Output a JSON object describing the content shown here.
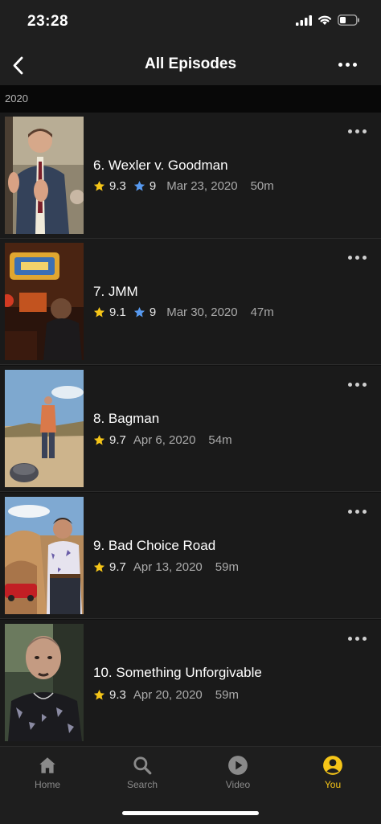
{
  "status_bar": {
    "time": "23:28"
  },
  "nav": {
    "title": "All Episodes"
  },
  "section": {
    "year": "2020"
  },
  "episodes": [
    {
      "title": "6. Wexler v. Goodman",
      "rating": "9.3",
      "user_rating": "9",
      "date": "Mar 23, 2020",
      "runtime": "50m"
    },
    {
      "title": "7. JMM",
      "rating": "9.1",
      "user_rating": "9",
      "date": "Mar 30, 2020",
      "runtime": "47m"
    },
    {
      "title": "8. Bagman",
      "rating": "9.7",
      "date": "Apr 6, 2020",
      "runtime": "54m"
    },
    {
      "title": "9. Bad Choice Road",
      "rating": "9.7",
      "date": "Apr 13, 2020",
      "runtime": "59m"
    },
    {
      "title": "10. Something Unforgivable",
      "rating": "9.3",
      "date": "Apr 20, 2020",
      "runtime": "59m"
    }
  ],
  "tabs": [
    {
      "label": "Home",
      "icon": "home-icon"
    },
    {
      "label": "Search",
      "icon": "search-icon"
    },
    {
      "label": "Video",
      "icon": "play-icon"
    },
    {
      "label": "You",
      "icon": "profile-icon",
      "active": true
    }
  ],
  "colors": {
    "accent": "#f5c518",
    "user_star": "#5799ef",
    "background": "#121212"
  }
}
